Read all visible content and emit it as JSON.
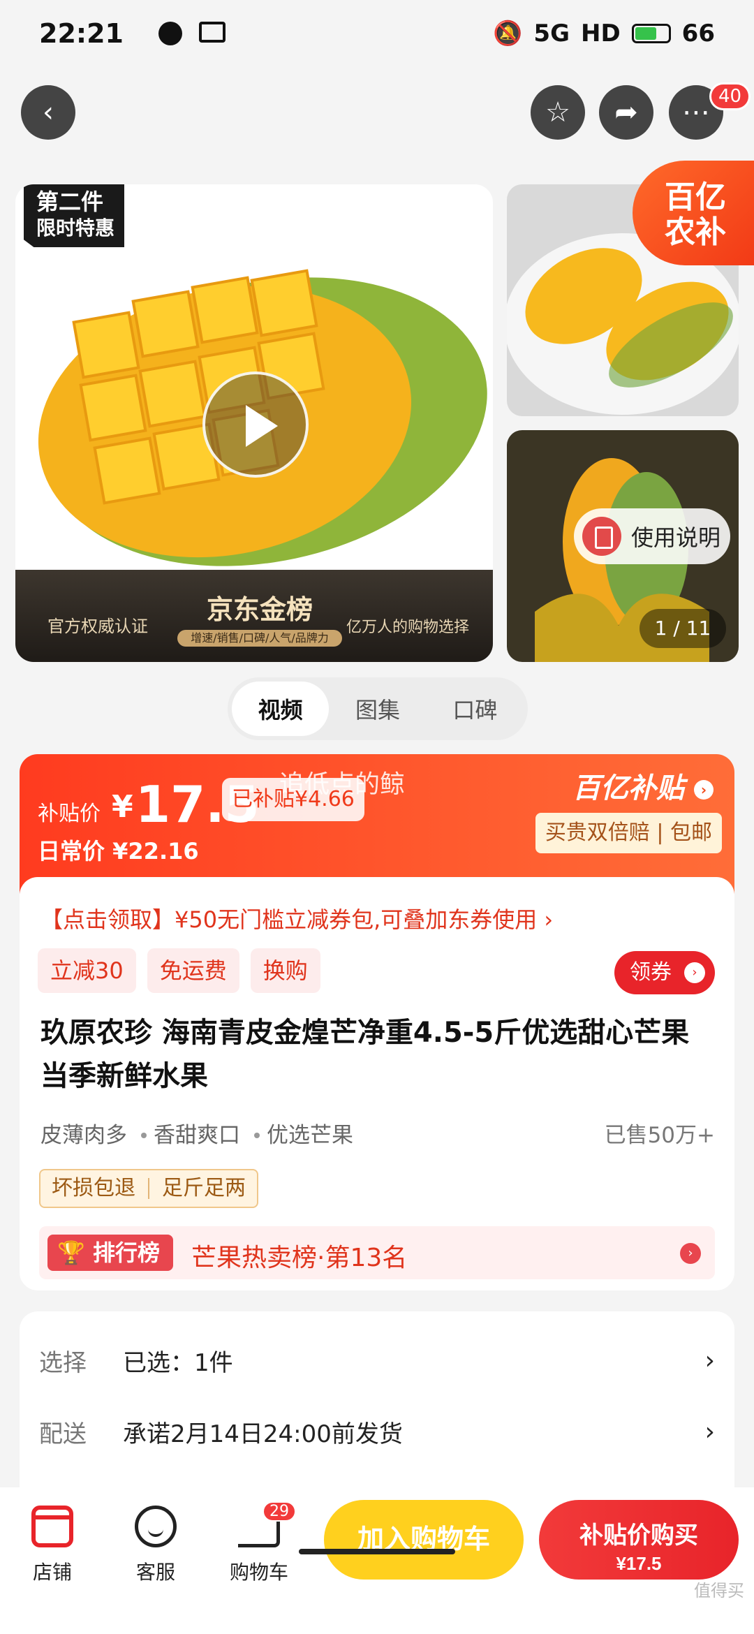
{
  "status": {
    "time": "22:21",
    "network": "5G",
    "hd": "HD",
    "battery": "66"
  },
  "nav": {
    "more_badge": "40"
  },
  "gallery": {
    "corner_tag_line1": "第二件",
    "corner_tag_line2": "限时特惠",
    "banner_left": "官方权威认证",
    "banner_brand": "京东金榜",
    "banner_sub": "增速/销售/口碑/人气/品牌力",
    "banner_right": "亿万人的购物选择",
    "yinongbu_line1": "百亿",
    "yinongbu_line2": "农补",
    "usage_label": "使用说明",
    "counter": "1 / 11"
  },
  "tabs": [
    {
      "label": "视频"
    },
    {
      "label": "图集"
    },
    {
      "label": "口碑"
    }
  ],
  "price": {
    "watermark": "追低点的鲸",
    "subsidy_label": "补贴价",
    "yen": "¥",
    "value": "17.5",
    "subsidized": "已补贴¥4.66",
    "daily": "日常价 ¥22.16",
    "brand": "百亿补贴",
    "assure": "买贵双倍赔 | 包邮"
  },
  "info": {
    "coupon_line": "【点击领取】¥50无门槛立减券包,可叠加东券使用 ›",
    "chips": [
      {
        "label": "立减30"
      },
      {
        "label": "免运费"
      },
      {
        "label": "换购"
      }
    ],
    "coupon_button": "领券",
    "title": "玖原农珍 海南青皮金煌芒净重4.5-5斤优选甜心芒果 当季新鲜水果",
    "features": [
      {
        "label": "皮薄肉多"
      },
      {
        "label": "香甜爽口"
      },
      {
        "label": "优选芒果"
      }
    ],
    "sold": "已售50万+",
    "guarantees": [
      {
        "label": "坏损包退"
      },
      {
        "label": "足斤足两"
      }
    ],
    "rank_badge": "排行榜",
    "rank_text": "芒果热卖榜·第13名"
  },
  "selection": {
    "rows": [
      {
        "key": "选择",
        "value": "已选：1件"
      },
      {
        "key": "配送",
        "value": "承诺2月14日24:00前发货"
      }
    ]
  },
  "bottom": {
    "shop": "店铺",
    "service": "客服",
    "cart": "购物车",
    "cart_badge": "29",
    "add_cart": "加入购物车",
    "buy_label": "补贴价购买",
    "buy_price": "¥17.5"
  },
  "corner_watermark": "值得买"
}
